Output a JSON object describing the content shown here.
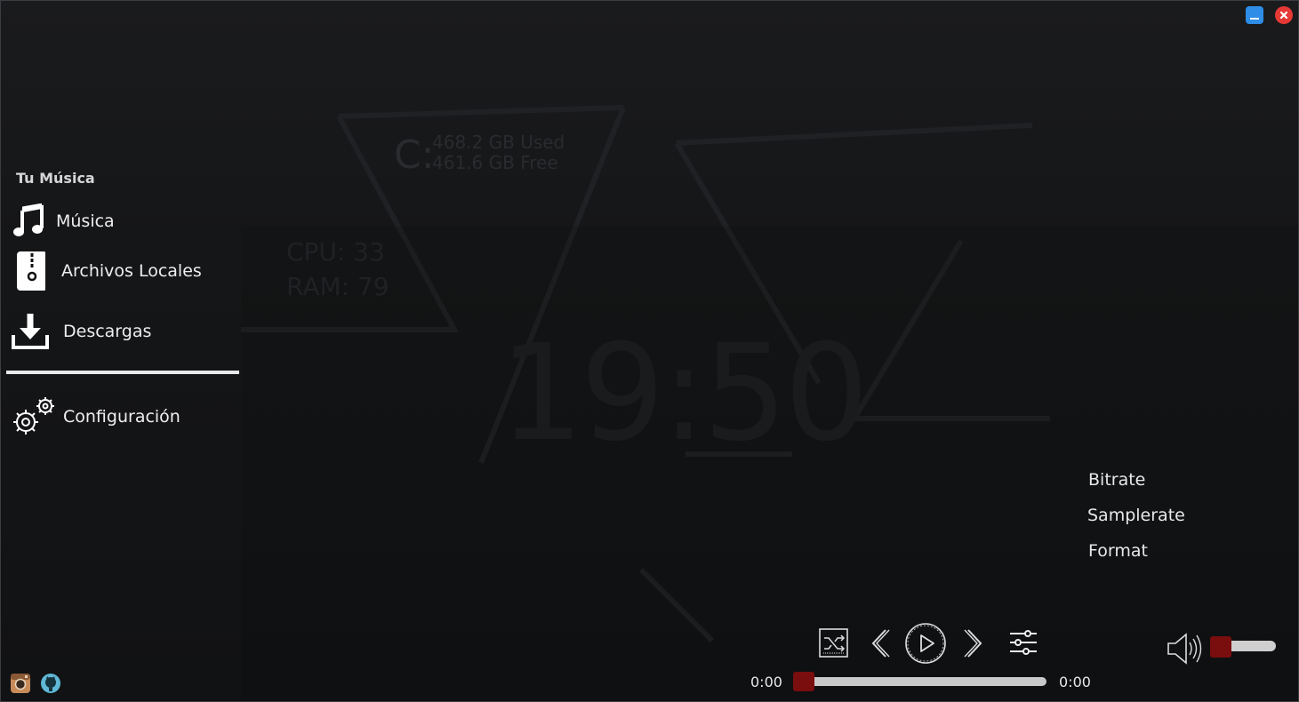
{
  "wallpaper": {
    "drive_letter": "C:",
    "drive_used": "468.2 GB Used",
    "drive_free": "461.6 GB Free",
    "cpu": "CPU: 33",
    "ram": "RAM: 79",
    "clock": "19:50"
  },
  "window_controls": {
    "minimize_color": "#2e8de6",
    "close_color": "#e53935"
  },
  "sidebar": {
    "section_title": "Tu Música",
    "items": [
      {
        "label": "Música",
        "icon": "music-note-icon"
      },
      {
        "label": "Archivos Locales",
        "icon": "zip-file-icon"
      },
      {
        "label": "Descargas",
        "icon": "download-icon"
      }
    ],
    "settings": {
      "label": "Configuración",
      "icon": "gears-icon"
    },
    "social": [
      {
        "icon": "instagram-icon"
      },
      {
        "icon": "github-icon"
      }
    ]
  },
  "audio_info": {
    "bitrate": "Bitrate",
    "samplerate": "Samplerate",
    "format": "Format"
  },
  "player": {
    "time_current": "0:00",
    "time_total": "0:00",
    "progress": 0,
    "volume": 0.1,
    "accent_color": "#7a0d0d"
  }
}
